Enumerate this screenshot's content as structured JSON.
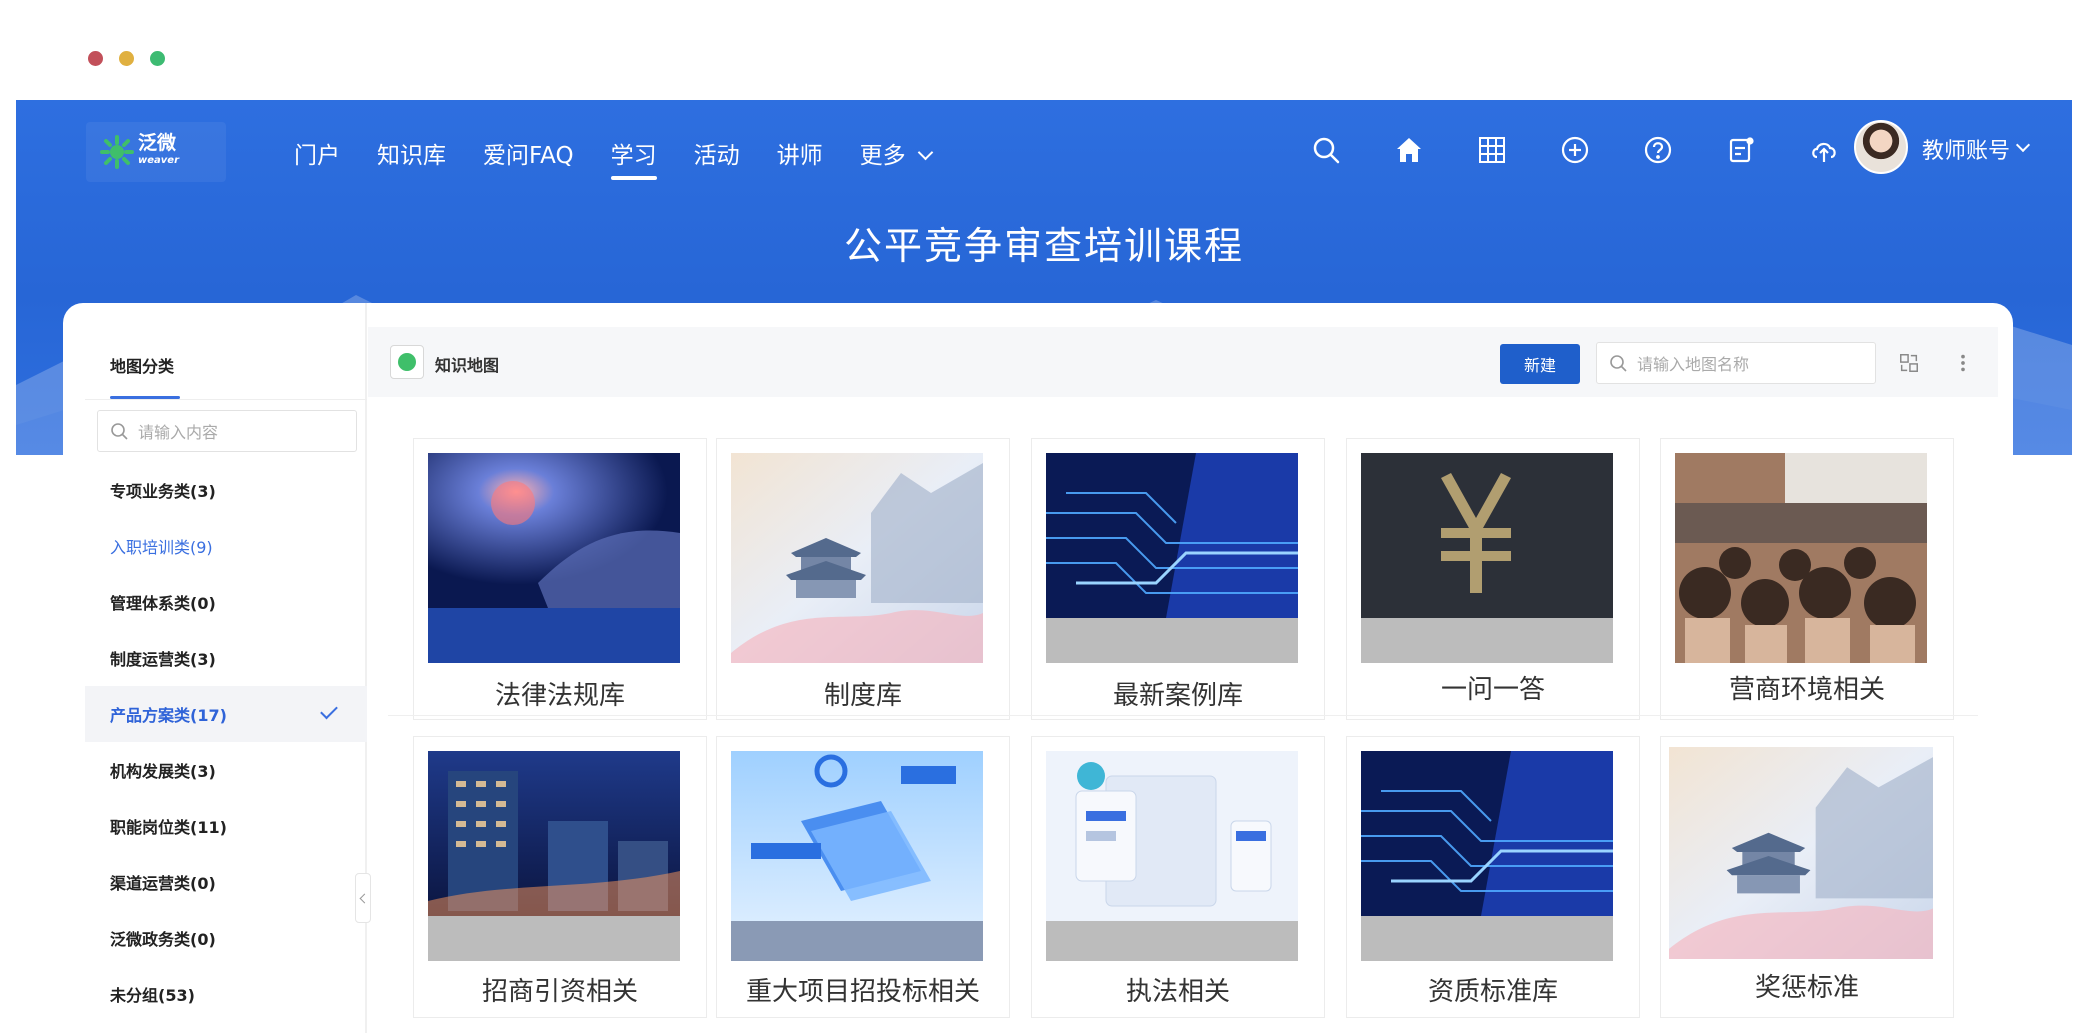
{
  "window": {
    "dot_colors": [
      "#c2505a",
      "#e0b040",
      "#3dbb72"
    ]
  },
  "colors": {
    "brand_blue": "#2766d6",
    "accent": "#3a6fe0",
    "button": "#1f5fcb"
  },
  "header": {
    "logo_text": "泛微",
    "logo_sub": "weaver",
    "nav": [
      {
        "label": "门户",
        "active": false
      },
      {
        "label": "知识库",
        "active": false
      },
      {
        "label": "爱问FAQ",
        "active": false
      },
      {
        "label": "学习",
        "active": true
      },
      {
        "label": "活动",
        "active": false
      },
      {
        "label": "讲师",
        "active": false
      },
      {
        "label": "更多",
        "active": false
      }
    ],
    "tools": [
      "search-icon",
      "home-icon",
      "grid-icon",
      "add-circle-icon",
      "help-icon",
      "notice-icon",
      "cloud-upload-icon"
    ],
    "account_label": "教师账号"
  },
  "banner": {
    "title": "公平竞争审查培训课程"
  },
  "sidebar": {
    "title": "地图分类",
    "search_placeholder": "请输入内容",
    "items": [
      {
        "label": "专项业务类(3)",
        "state": "normal"
      },
      {
        "label": "入职培训类(9)",
        "state": "link"
      },
      {
        "label": "管理体系类(0)",
        "state": "normal"
      },
      {
        "label": "制度运营类(3)",
        "state": "normal"
      },
      {
        "label": "产品方案类(17)",
        "state": "selected"
      },
      {
        "label": "机构发展类(3)",
        "state": "normal"
      },
      {
        "label": "职能岗位类(11)",
        "state": "normal"
      },
      {
        "label": "渠道运营类(0)",
        "state": "normal"
      },
      {
        "label": "泛微政务类(0)",
        "state": "normal"
      },
      {
        "label": "未分组(53)",
        "state": "normal"
      }
    ]
  },
  "content": {
    "title": "知识地图",
    "new_button": "新建",
    "search_placeholder": "请输入地图名称",
    "tiles": [
      {
        "label": "法律法规库",
        "image": "tech-hand"
      },
      {
        "label": "制度库",
        "image": "temple"
      },
      {
        "label": "最新案例库",
        "image": "circuit"
      },
      {
        "label": "一问一答",
        "image": "yuan"
      },
      {
        "label": "营商环境相关",
        "image": "seminar"
      },
      {
        "label": "招商引资相关",
        "image": "city"
      },
      {
        "label": "重大项目招投标相关",
        "image": "folder"
      },
      {
        "label": "执法相关",
        "image": "portal"
      },
      {
        "label": "资质标准库",
        "image": "circuit"
      },
      {
        "label": "奖惩标准",
        "image": "temple"
      }
    ]
  }
}
